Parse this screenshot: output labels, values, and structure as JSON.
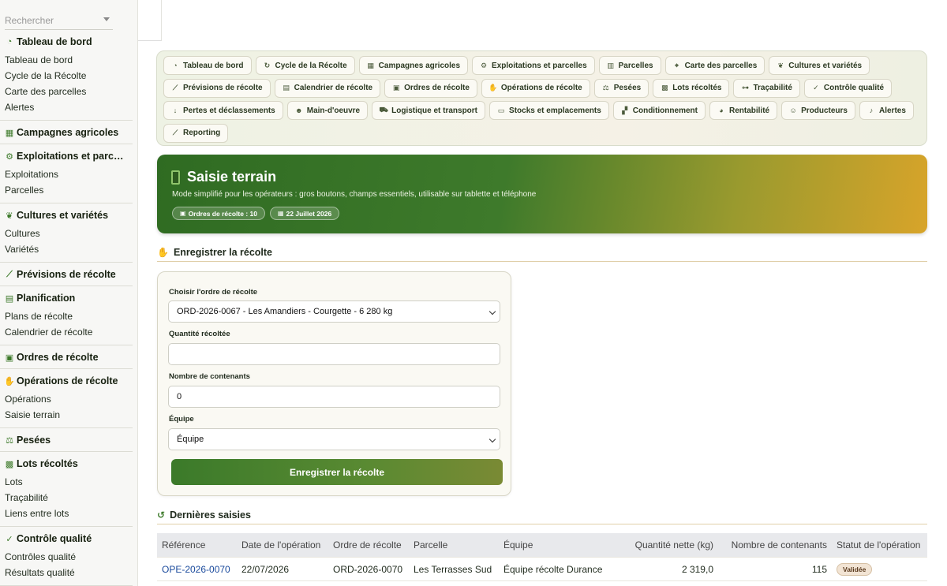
{
  "search": {
    "placeholder": "Rechercher"
  },
  "sidebar": {
    "groups": [
      {
        "title": "Tableau de bord",
        "icon": "gauge-icon",
        "items": [
          "Tableau de bord",
          "Cycle de la Récolte",
          "Carte des parcelles",
          "Alertes"
        ]
      },
      {
        "title": "Campagnes agricoles",
        "icon": "calendar-icon",
        "items": []
      },
      {
        "title": "Exploitations et parc…",
        "icon": "tractor-icon",
        "items": [
          "Exploitations",
          "Parcelles"
        ]
      },
      {
        "title": "Cultures et variétés",
        "icon": "seedling-icon",
        "items": [
          "Cultures",
          "Variétés"
        ]
      },
      {
        "title": "Prévisions de récolte",
        "icon": "chart-line-icon",
        "items": []
      },
      {
        "title": "Planification",
        "icon": "calendar-check-icon",
        "items": [
          "Plans de récolte",
          "Calendrier de récolte"
        ]
      },
      {
        "title": "Ordres de récolte",
        "icon": "clipboard-check-icon",
        "items": []
      },
      {
        "title": "Opérations de récolte",
        "icon": "hand-icon",
        "items": [
          "Opérations",
          "Saisie terrain"
        ]
      },
      {
        "title": "Pesées",
        "icon": "scale-icon",
        "items": []
      },
      {
        "title": "Lots récoltés",
        "icon": "box-icon",
        "items": [
          "Lots",
          "Traçabilité",
          "Liens entre lots"
        ]
      },
      {
        "title": "Contrôle qualité",
        "icon": "quality-icon",
        "items": [
          "Contrôles qualité",
          "Résultats qualité"
        ]
      }
    ]
  },
  "nav": {
    "rows": [
      [
        {
          "label": "Tableau de bord",
          "icon": "gauge-icon",
          "glyph": "◔"
        },
        {
          "label": "Cycle de la Récolte",
          "icon": "refresh-icon",
          "glyph": "↻"
        },
        {
          "label": "Campagnes agricoles",
          "icon": "calendar-icon",
          "glyph": "▦"
        },
        {
          "label": "Exploitations et parcelles",
          "icon": "tractor-icon",
          "glyph": "⚙"
        },
        {
          "label": "Parcelles",
          "icon": "map-icon",
          "glyph": "▥"
        },
        {
          "label": "Carte des parcelles",
          "icon": "map-location-icon",
          "glyph": "⌖"
        },
        {
          "label": "Cultures et variétés",
          "icon": "seedling-icon",
          "glyph": "❦"
        }
      ],
      [
        {
          "label": "Prévisions de récolte",
          "icon": "chart-line-icon",
          "glyph": "⟋"
        },
        {
          "label": "Calendrier de récolte",
          "icon": "calendar-check-icon",
          "glyph": "▤"
        },
        {
          "label": "Ordres de récolte",
          "icon": "clipboard-check-icon",
          "glyph": "▣"
        },
        {
          "label": "Opérations de récolte",
          "icon": "hand-icon",
          "glyph": "✋"
        },
        {
          "label": "Pesées",
          "icon": "scale-icon",
          "glyph": "⚖"
        },
        {
          "label": "Lots récoltés",
          "icon": "box-icon",
          "glyph": "▩"
        },
        {
          "label": "Traçabilité",
          "icon": "sitemap-icon",
          "glyph": "⊶"
        },
        {
          "label": "Contrôle qualité",
          "icon": "quality-icon",
          "glyph": "✓"
        }
      ],
      [
        {
          "label": "Pertes et déclassements",
          "icon": "arrow-down-icon",
          "glyph": "↓"
        },
        {
          "label": "Main-d'oeuvre",
          "icon": "users-icon",
          "glyph": "☻"
        },
        {
          "label": "Logistique et transport",
          "icon": "truck-icon",
          "glyph": "⛟"
        },
        {
          "label": "Stocks et emplacements",
          "icon": "warehouse-icon",
          "glyph": "▭"
        },
        {
          "label": "Conditionnement",
          "icon": "boxes-icon",
          "glyph": "▞"
        },
        {
          "label": "Rentabilité",
          "icon": "pie-chart-icon",
          "glyph": "◕"
        },
        {
          "label": "Producteurs",
          "icon": "user-group-icon",
          "glyph": "☺"
        },
        {
          "label": "Alertes",
          "icon": "bell-icon",
          "glyph": "♪"
        }
      ],
      [
        {
          "label": "Reporting",
          "icon": "chart-area-icon",
          "glyph": "⟋"
        }
      ]
    ]
  },
  "hero": {
    "title": "Saisie terrain",
    "subtitle": "Mode simplifié pour les opérateurs : gros boutons, champs essentiels, utilisable sur tablette et téléphone",
    "badge_orders": "Ordres de récolte : 10",
    "badge_date": "22 Juillet 2026"
  },
  "form_section": {
    "title": "Enregistrer la récolte"
  },
  "form": {
    "order_label": "Choisir l'ordre de récolte",
    "order_value": "ORD-2026-0067 - Les Amandiers - Courgette - 6 280 kg",
    "quantity_label": "Quantité récoltée",
    "quantity_value": "",
    "containers_label": "Nombre de contenants",
    "containers_value": "0",
    "team_label": "Équipe",
    "team_value": "Équipe",
    "submit_label": "Enregistrer la récolte"
  },
  "recent_section": {
    "title": "Dernières saisies"
  },
  "table": {
    "headers": [
      "Référence",
      "Date de l'opération",
      "Ordre de récolte",
      "Parcelle",
      "Équipe",
      "Quantité nette (kg)",
      "Nombre de contenants",
      "Statut de l'opération"
    ],
    "rows": [
      [
        "OPE-2026-0070",
        "22/07/2026",
        "ORD-2026-0070",
        "Les Terrasses Sud",
        "Équipe récolte Durance",
        "2 319,0",
        "115",
        "Validée"
      ]
    ]
  },
  "colors": {
    "primary": "#3d7a2a",
    "accent": "#d8a42a",
    "link": "#1a4a9c"
  }
}
